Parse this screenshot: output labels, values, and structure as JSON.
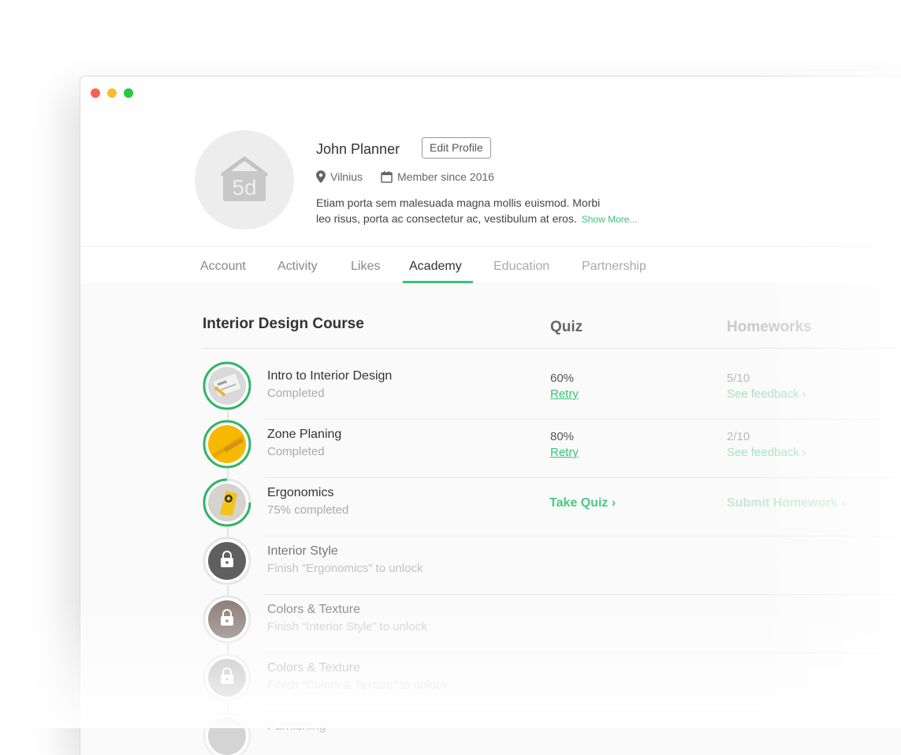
{
  "profile": {
    "name": "John Planner",
    "edit_label": "Edit Profile",
    "location": "Vilnius",
    "member_since": "Member since 2016",
    "bio_line1": "Etiam porta sem malesuada magna mollis euismod. Morbi",
    "bio_line2": "leo risus, porta ac consectetur ac, vestibulum at eros.",
    "show_more": "Show More...",
    "logo_text": "5d"
  },
  "tabs": [
    {
      "label": "Account"
    },
    {
      "label": "Activity"
    },
    {
      "label": "Likes"
    },
    {
      "label": "Academy"
    },
    {
      "label": "Education"
    },
    {
      "label": "Partnership"
    }
  ],
  "course": {
    "title": "Interior Design Course",
    "quiz_header": "Quiz",
    "homework_header": "Homeworks",
    "lessons": [
      {
        "title": "Intro to Interior Design",
        "status": "Completed",
        "quiz_score": "60%",
        "quiz_action": "Retry",
        "hw_score": "5/10",
        "hw_action": "See feedback ›",
        "progress": 1.0
      },
      {
        "title": "Zone Planing",
        "status": "Completed",
        "quiz_score": "80%",
        "quiz_action": "Retry",
        "hw_score": "2/10",
        "hw_action": "See feedback ›",
        "progress": 1.0
      },
      {
        "title": "Ergonomics",
        "status": "75% completed",
        "quiz_action": "Take Quiz ›",
        "hw_action": "Submit Homework ›",
        "progress": 0.75
      },
      {
        "title": "Interior Style",
        "status": "Finish “Ergonomics” to unlock"
      },
      {
        "title": "Colors & Texture",
        "status": "Finish “Interior Style” to unlock"
      },
      {
        "title": "Colors & Texture",
        "status": "Finish “Colors & Texture” to unlock"
      },
      {
        "title": "Furnishing"
      }
    ]
  },
  "colors": {
    "accent": "#3cc27a",
    "traffic_red": "#fc5f57",
    "traffic_yellow": "#fdbc2e",
    "traffic_green": "#28c840"
  }
}
